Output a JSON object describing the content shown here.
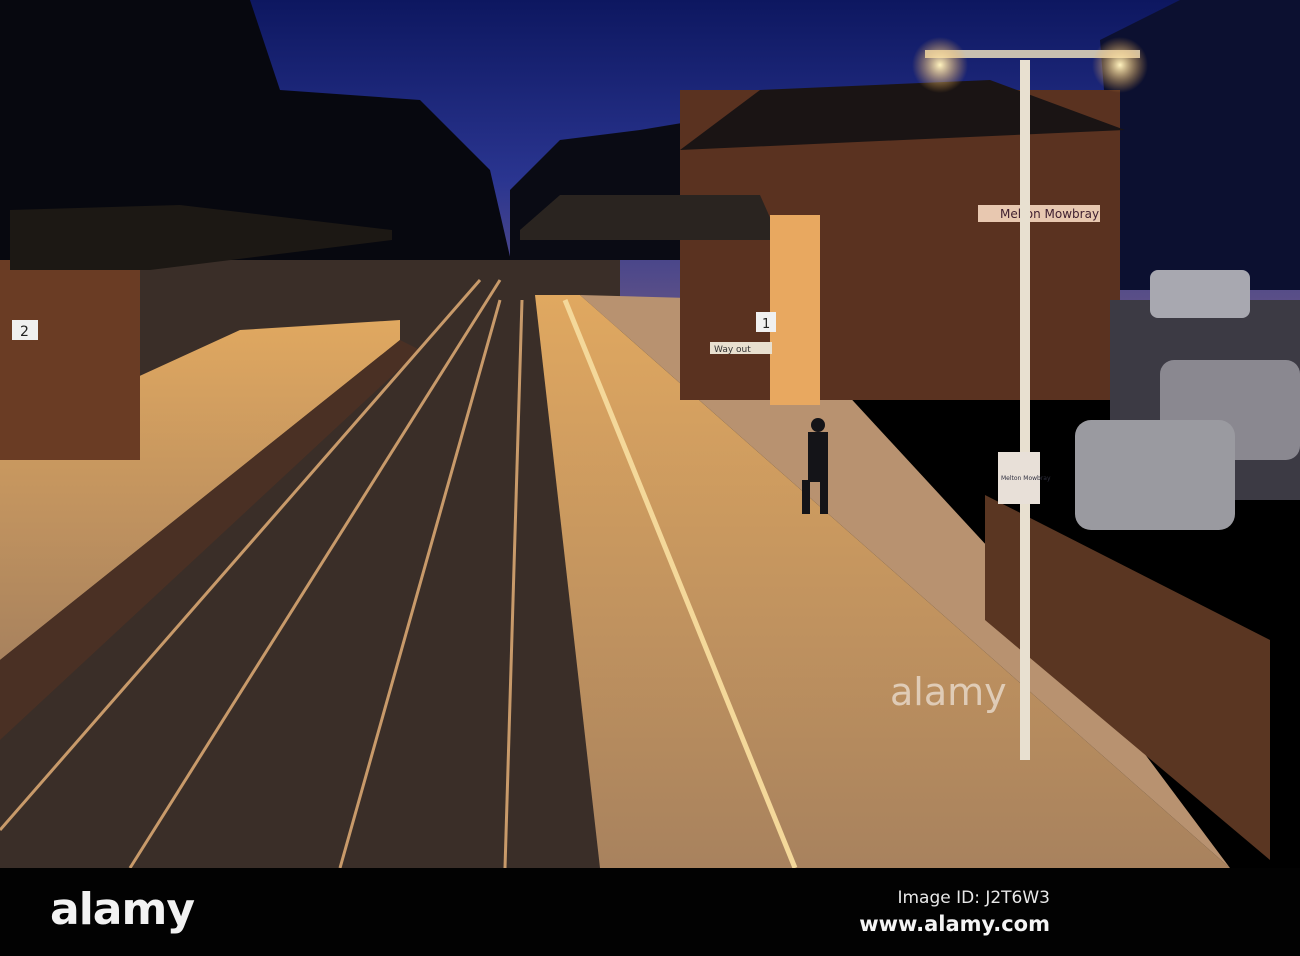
{
  "photo": {
    "station_sign": "Melton Mowbray",
    "totem_sign": "Melton Mowbray",
    "platform_left_number": "2",
    "platform_right_number": "1",
    "way_out_sign": "Way out"
  },
  "footer": {
    "logo": "alamy",
    "image_id": "Image ID: J2T6W3",
    "url": "www.alamy.com"
  },
  "watermark": "alamy",
  "colors": {
    "sky_top": "#0f1a66",
    "sky_horizon": "#4a4f9a",
    "lamp_glow": "#ffd27a",
    "platform": "#b88a5a"
  }
}
